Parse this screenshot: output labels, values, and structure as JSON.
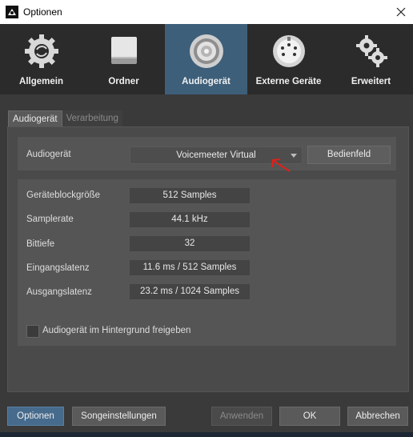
{
  "window": {
    "title": "Optionen"
  },
  "categories": [
    {
      "label": "Allgemein",
      "icon": "gear-icon",
      "active": false
    },
    {
      "label": "Ordner",
      "icon": "folder-drive-icon",
      "active": false
    },
    {
      "label": "Audiogerät",
      "icon": "speaker-icon",
      "active": true
    },
    {
      "label": "Externe Geräte",
      "icon": "midi-connector-icon",
      "active": false
    },
    {
      "label": "Erweitert",
      "icon": "gears-icon",
      "active": false
    }
  ],
  "tabs": {
    "active": "Audiogerät",
    "inactive": "Verarbeitung"
  },
  "device": {
    "label": "Audiogerät",
    "selected": "Voicemeeter Virtual",
    "control_panel_button": "Bedienfeld"
  },
  "settings": {
    "block_size_label": "Geräteblockgröße",
    "block_size_value": "512 Samples",
    "samplerate_label": "Samplerate",
    "samplerate_value": "44.1 kHz",
    "bit_depth_label": "Bittiefe",
    "bit_depth_value": "32",
    "input_latency_label": "Eingangslatenz",
    "input_latency_value": "11.6 ms / 512 Samples",
    "output_latency_label": "Ausgangslatenz",
    "output_latency_value": "23.2 ms / 1024 Samples",
    "background_checkbox_label": "Audiogerät im Hintergrund freigeben",
    "background_checked": false
  },
  "footer": {
    "options_button": "Optionen",
    "song_settings_button": "Songeinstellungen",
    "apply_button": "Anwenden",
    "ok_button": "OK",
    "cancel_button": "Abbrechen"
  },
  "colors": {
    "active_category": "#3d5f7a",
    "annotation": "#e0201a"
  }
}
